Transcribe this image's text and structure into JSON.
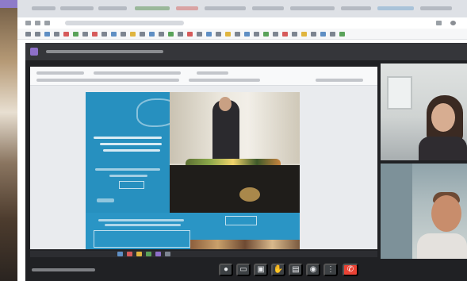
{
  "browser": {
    "tab_title": "",
    "address": ""
  },
  "call": {
    "window_title": "",
    "meeting_info": "",
    "participants": [
      {
        "name": ""
      },
      {
        "name": ""
      }
    ],
    "controls": [
      {
        "icon": "mic-icon",
        "glyph": "●"
      },
      {
        "icon": "camera-icon",
        "glyph": "▭"
      },
      {
        "icon": "share-screen-icon",
        "glyph": "▣"
      },
      {
        "icon": "hand-icon",
        "glyph": "✋"
      },
      {
        "icon": "chat-icon",
        "glyph": "▤"
      },
      {
        "icon": "people-icon",
        "glyph": "◉"
      },
      {
        "icon": "more-icon",
        "glyph": "⋮"
      },
      {
        "icon": "end-call-icon",
        "glyph": "✆"
      }
    ]
  },
  "shared_screen": {
    "slide_heading": "",
    "slide_body": ""
  },
  "colors": {
    "call_background": "#202124",
    "slide_blue": "#2790bf",
    "end_call_red": "#ea4335",
    "app_accent": "#8e6fc9"
  }
}
